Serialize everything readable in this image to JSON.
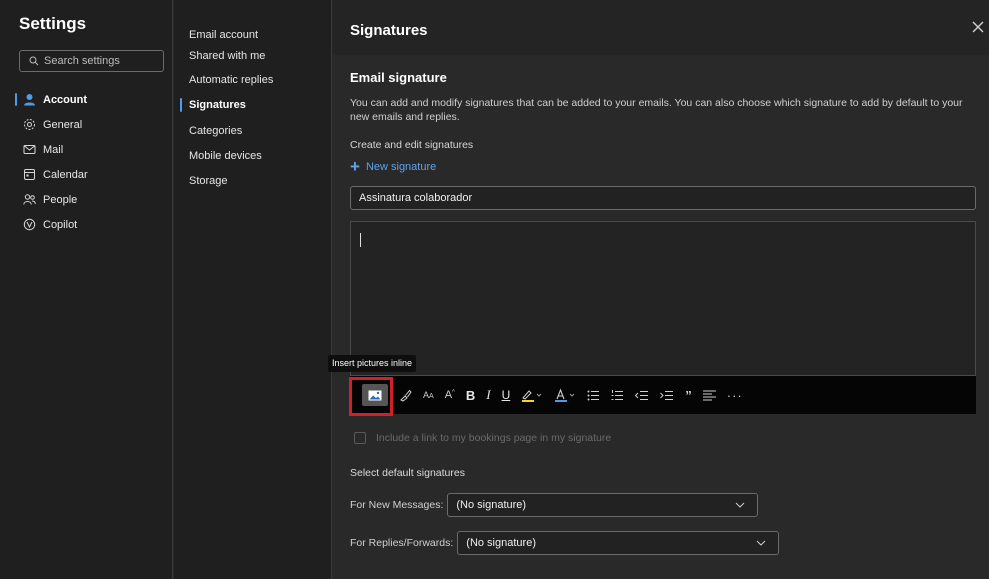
{
  "left_nav": {
    "title": "Settings",
    "search_placeholder": "Search settings",
    "items": [
      {
        "label": "Account",
        "icon": "person-icon",
        "active": true
      },
      {
        "label": "General",
        "icon": "gear-icon"
      },
      {
        "label": "Mail",
        "icon": "mail-icon"
      },
      {
        "label": "Calendar",
        "icon": "calendar-icon"
      },
      {
        "label": "People",
        "icon": "people-icon"
      },
      {
        "label": "Copilot",
        "icon": "copilot-icon"
      }
    ]
  },
  "sub_nav": {
    "items": [
      {
        "label": "Email account"
      },
      {
        "label": "Shared with me"
      },
      {
        "label": "Automatic replies"
      },
      {
        "label": "Signatures",
        "active": true
      },
      {
        "label": "Categories"
      },
      {
        "label": "Mobile devices"
      },
      {
        "label": "Storage"
      }
    ]
  },
  "panel": {
    "title": "Signatures",
    "section_title": "Email signature",
    "description": "You can add and modify signatures that can be added to your emails. You can also choose which signature to add by default to your new emails and replies.",
    "create_label": "Create and edit signatures",
    "new_signature_label": "New signature",
    "signature_name": "Assinatura colaborador",
    "tooltip": "Insert pictures inline",
    "bookings_checkbox_label": "Include a link to my bookings page in my signature",
    "select_default_label": "Select default signatures",
    "new_messages_label": "For New Messages:",
    "new_messages_value": "(No signature)",
    "replies_label": "For Replies/Forwards:",
    "replies_value": "(No signature)"
  },
  "toolbar": {
    "icons": [
      "insert-picture-icon",
      "format-painter-icon",
      "font-size-decrease-icon",
      "font-size-increase-icon",
      "bold-icon",
      "italic-icon",
      "underline-icon",
      "highlight-icon",
      "font-color-icon",
      "bullets-icon",
      "numbering-icon",
      "decrease-indent-icon",
      "increase-indent-icon",
      "quote-icon",
      "align-icon",
      "more-options-icon"
    ]
  },
  "colors": {
    "accent": "#4f9be8",
    "link": "#5aa3ee",
    "highlight_box": "#d0202b"
  }
}
